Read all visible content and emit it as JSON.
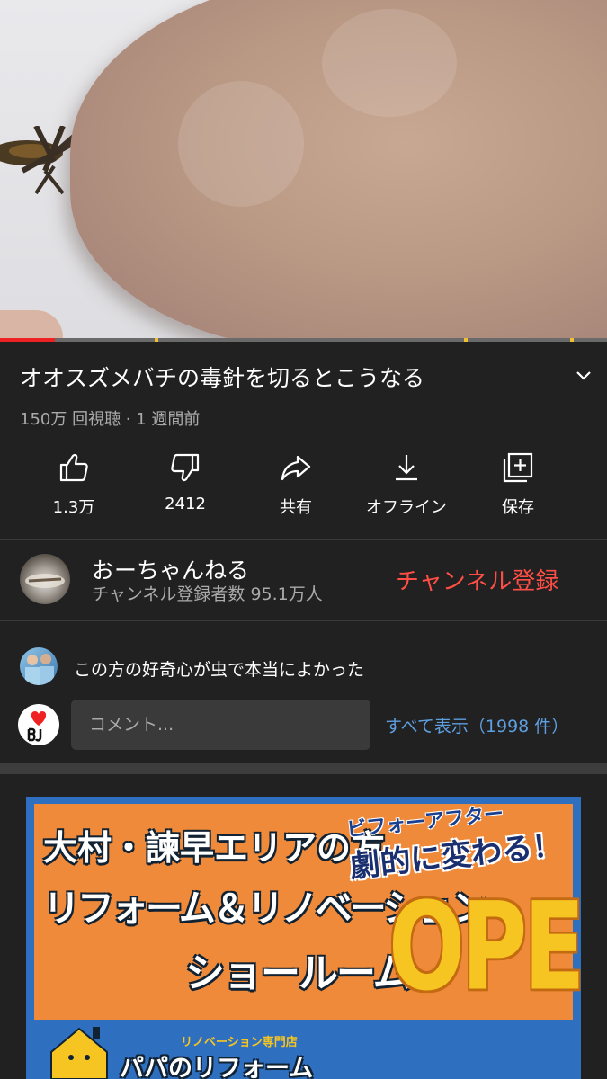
{
  "video": {
    "title": "オオスズメバチの毒針を切るとこうなる",
    "meta": "150万 回視聴 · 1 週間前",
    "progress_fraction": 0.09
  },
  "actions": [
    {
      "label": "1.3万",
      "icon": "thumbs-up-icon"
    },
    {
      "label": "2412",
      "icon": "thumbs-down-icon"
    },
    {
      "label": "共有",
      "icon": "share-icon"
    },
    {
      "label": "オフライン",
      "icon": "download-icon"
    },
    {
      "label": "保存",
      "icon": "save-to-playlist-icon"
    }
  ],
  "channel": {
    "name": "おーちゃんねる",
    "subscribers": "チャンネル登録者数 95.1万人",
    "subscribe_label": "チャンネル登録"
  },
  "comments": {
    "top_comment": "この方の好奇心が虫で本当によかった",
    "input_placeholder": "コメント...",
    "show_all": "すべて表示（1998 件）"
  },
  "ad": {
    "line1": "大村・諫早エリアの方",
    "line2": "リフォーム＆リノベーション",
    "line3": "ショールーム",
    "before_after": "ビフォーアフター",
    "dramatic": "劇的に変わる！",
    "open": "OPEN",
    "brand_tag": "リノベーション専門店",
    "brand": "パパのリフォーム"
  },
  "colors": {
    "background": "#212121",
    "subscribe": "#ff4e45",
    "link": "#5e9fe0",
    "progress": "#ee2222"
  }
}
